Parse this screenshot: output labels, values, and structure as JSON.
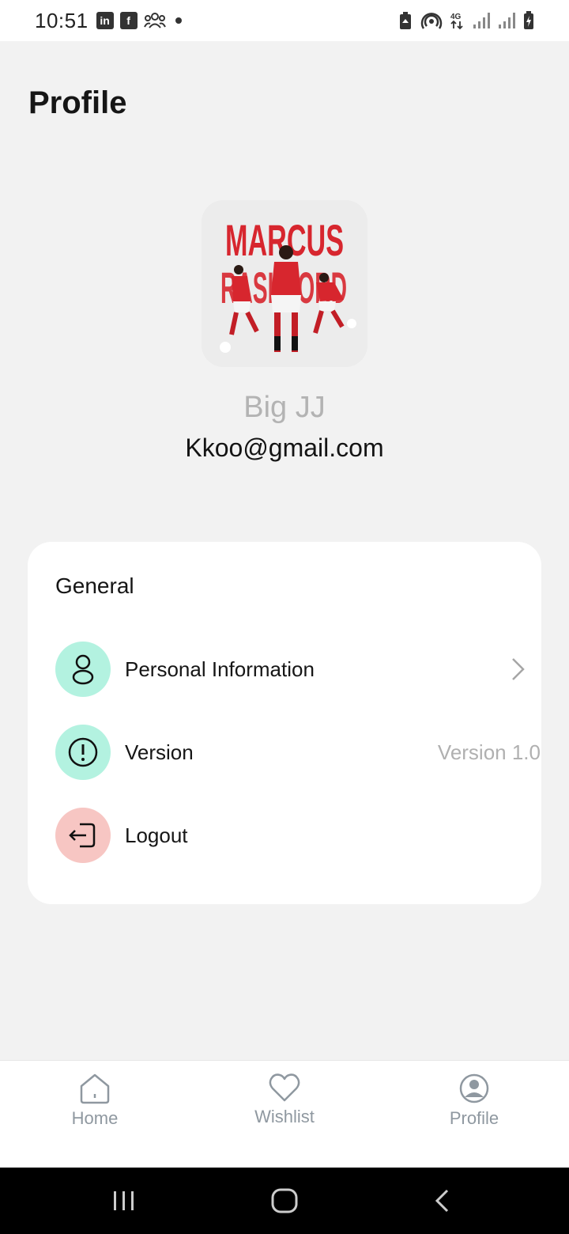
{
  "status_bar": {
    "time": "10:51",
    "left_icons": [
      "linkedin-icon",
      "facebook-icon",
      "group-icon",
      "dot-icon"
    ],
    "right_icons": [
      "battery-saver-icon",
      "hotspot-icon",
      "4g-icon",
      "signal-icon",
      "signal-icon",
      "battery-charging-icon"
    ],
    "network": "4G"
  },
  "page": {
    "title": "Profile"
  },
  "profile": {
    "name": "Big JJ",
    "email": "Kkoo@gmail.com",
    "avatar_text_top": "MARCUS",
    "avatar_text_bottom": "RASHFORD"
  },
  "general": {
    "title": "General",
    "items": [
      {
        "label": "Personal Information",
        "icon": "person-icon",
        "trailing": "chevron-right-icon"
      },
      {
        "label": "Version",
        "icon": "info-icon",
        "value": "Version 1.0"
      },
      {
        "label": "Logout",
        "icon": "logout-icon"
      }
    ]
  },
  "bottom_nav": {
    "items": [
      {
        "label": "Home",
        "icon": "home-icon"
      },
      {
        "label": "Wishlist",
        "icon": "heart-icon"
      },
      {
        "label": "Profile",
        "icon": "profile-icon"
      }
    ]
  },
  "system_nav": [
    "recents-icon",
    "home-circle-icon",
    "back-icon"
  ],
  "colors": {
    "background": "#f2f2f2",
    "card": "#ffffff",
    "mint": "#b3f2e0",
    "pink": "#f7c6c3",
    "nav_label": "#8f98a0",
    "avatar_red": "#d7262e"
  }
}
